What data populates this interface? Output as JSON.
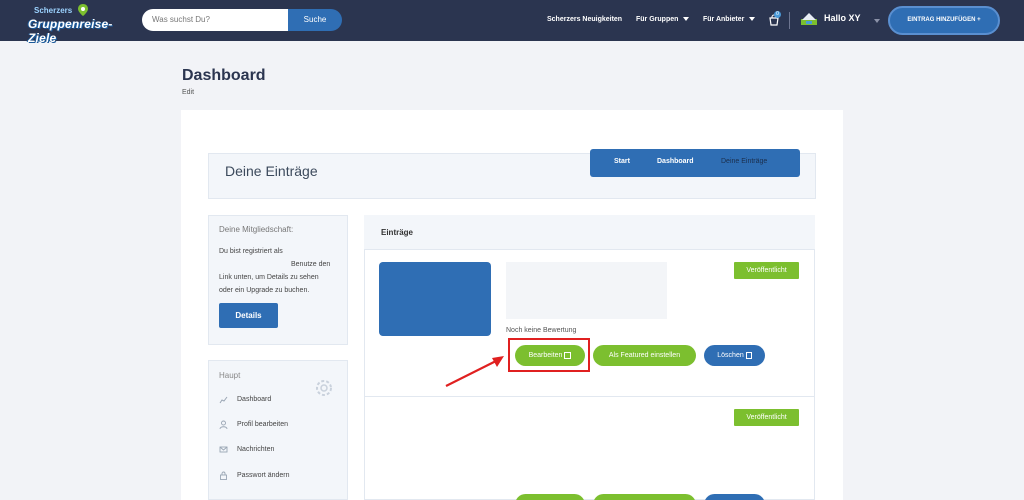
{
  "header": {
    "logo_top": "Scherzers",
    "logo_main": "Gruppenreise-Ziele",
    "search_placeholder": "Was suchst Du?",
    "search_button": "Suche",
    "nav": {
      "news": "Scherzers Neuigkeiten",
      "groups": "Für Gruppen",
      "providers": "Für Anbieter"
    },
    "cart_count": "0",
    "greeting": "Hallo XY",
    "add_entry": "EINTRAG HINZUFÜGEN +"
  },
  "page": {
    "title": "Dashboard",
    "subtitle": "Edit"
  },
  "entries_header": {
    "title": "Deine Einträge",
    "breadcrumbs": [
      "Start",
      "Dashboard",
      "Deine Einträge"
    ]
  },
  "membership": {
    "title": "Deine Mitgliedschaft:",
    "lines": [
      "Du bist registriert als",
      "Benutze den",
      "Link unten, um Details zu sehen",
      "oder ein Upgrade zu buchen."
    ],
    "details_button": "Details"
  },
  "menu": {
    "title": "Haupt",
    "items": [
      {
        "label": "Dashboard",
        "icon": "chart-icon"
      },
      {
        "label": "Profil bearbeiten",
        "icon": "user-icon"
      },
      {
        "label": "Nachrichten",
        "icon": "mail-icon"
      },
      {
        "label": "Passwort ändern",
        "icon": "lock-icon"
      }
    ]
  },
  "entries_panel": {
    "title": "Einträge",
    "entry": {
      "status": "Veröffentlicht",
      "rating": "Noch keine Bewertung",
      "edit_button": "Bearbeiten",
      "feature_button": "Als Featured einstellen",
      "delete_button": "Löschen"
    },
    "entry2": {
      "status": "Veröffentlicht"
    }
  },
  "colors": {
    "header_bg": "#2b3550",
    "primary_blue": "#2f6eb4",
    "green": "#7cbf2f",
    "highlight_red": "#e02020"
  }
}
